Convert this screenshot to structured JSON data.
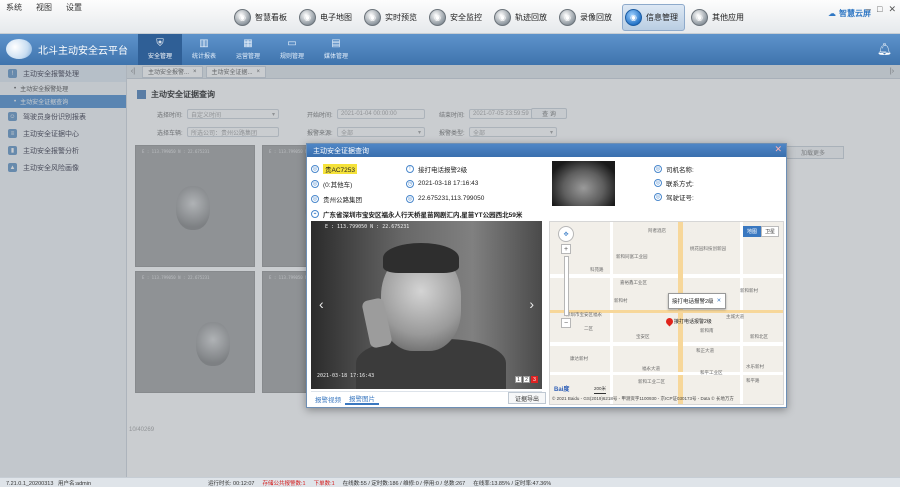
{
  "menubar": {
    "items": [
      "系统",
      "视图",
      "设置"
    ],
    "modules": [
      {
        "label": "智慧看板",
        "icon": "dashboard-icon",
        "active": false
      },
      {
        "label": "电子地图",
        "icon": "map-icon",
        "active": false
      },
      {
        "label": "实时预览",
        "icon": "preview-icon",
        "active": false
      },
      {
        "label": "安全监控",
        "icon": "monitor-icon",
        "active": false
      },
      {
        "label": "轨迹回放",
        "icon": "track-icon",
        "active": false
      },
      {
        "label": "录像回放",
        "icon": "video-icon",
        "active": false
      },
      {
        "label": "信息管理",
        "icon": "info-icon",
        "active": true
      },
      {
        "label": "其他应用",
        "icon": "apps-icon",
        "active": false
      }
    ],
    "brand_right": "智慧云屏"
  },
  "header": {
    "app_title": "北斗主动安全云平台",
    "tabs": [
      {
        "label": "安全管理",
        "icon": "shield-icon",
        "active": true
      },
      {
        "label": "统计报表",
        "icon": "chart-icon",
        "active": false
      },
      {
        "label": "运营管理",
        "icon": "ops-icon",
        "active": false
      },
      {
        "label": "规则管理",
        "icon": "rules-icon",
        "active": false
      },
      {
        "label": "媒体管理",
        "icon": "media-icon",
        "active": false
      }
    ]
  },
  "sidebar": {
    "items": [
      {
        "label": "主动安全报警处理",
        "icon": "alarm-icon",
        "parent": true
      },
      {
        "label": "主动安全报警处理",
        "sub": true,
        "active": false
      },
      {
        "label": "主动安全证据查询",
        "sub": true,
        "active": true
      },
      {
        "label": "驾驶员身份识别报表",
        "icon": "driver-icon"
      },
      {
        "label": "主动安全证据中心",
        "icon": "evidence-icon"
      },
      {
        "label": "主动安全报警分析",
        "icon": "analysis-icon"
      },
      {
        "label": "主动安全风险画像",
        "icon": "risk-icon"
      }
    ]
  },
  "tabstrip": {
    "tabs": [
      "主动安全报警...",
      "主动安全证据..."
    ]
  },
  "main": {
    "page_title": "主动安全证据查询",
    "filters": {
      "time_label": "选择时间:",
      "time_value": "自定义时间",
      "start_label": "开始时间:",
      "start_value": "2021-01-04 00:00:00",
      "end_label": "结束时间:",
      "end_value": "2021-07-05 23:59:59",
      "company_label": "选择车辆:",
      "company_value": "所选公司：贵州公路集团",
      "alarm_source_label": "报警来源:",
      "alarm_source_value": "全部",
      "alarm_type_label": "报警类型:",
      "alarm_type_value": "全部"
    },
    "query_button": "查 询",
    "load_more": "加载更多",
    "page_count": "10/40269",
    "thumbnail_timestamp": "E : 113.799050  N : 22.675231"
  },
  "modal": {
    "title": "主动安全证据查询",
    "plate": "贵AC7253",
    "alarm_type": "接打电话报警2级",
    "vehicle_color": "(0:其他车)",
    "time": "2021-03-18 17:16:43",
    "company": "贵州公路集团",
    "coords": "22.675231,113.799050",
    "address": "广东省深圳市宝安区福永人行天桥星苗网剧汇内,星苗YT公园西北59米",
    "driver_name_label": "司机名称:",
    "contact_label": "联系方式:",
    "license_label": "驾驶证号:",
    "video_overlay": "E : 113.799050  N : 22.675231",
    "video_date": "2021-03-18  17:16:43",
    "pager": [
      "1",
      "2",
      "3"
    ],
    "pager_current": "3",
    "bottom_tabs": [
      "报警视频",
      "报警图片"
    ],
    "bottom_tab_active": "报警图片",
    "export_button": "证据导出",
    "map": {
      "type_buttons": [
        "地图",
        "卫星"
      ],
      "type_selected": "地图",
      "popup_text": "接打电话报警2级",
      "pin_label": "接打电话报警2级",
      "scale": "200米",
      "logo": "Bai度",
      "copyright": "© 2021 Baidu - GS(2019)6218号 - 甲测资字1100930 - 京ICP证030173号 - Data © 长地万方",
      "labels": [
        "阿者酒店",
        "新和同富工业园",
        "桃花园科技创新园",
        "科苑路",
        "嘉裕鑫工业区",
        "新和村",
        "深圳市宝安区福永",
        "新和新村",
        "新和北区",
        "二区",
        "宝安区",
        "新和南",
        "康达新村",
        "和正大道",
        "福永大道",
        "新和工业二区",
        "和平工业区",
        "水乐新村",
        "主城大道",
        "和平路"
      ]
    }
  },
  "statusbar": {
    "version": "7.21.0.1_20200313",
    "user": "用户名:admin",
    "runtime": "运行时长: 00:12:07",
    "alarm_label": "存储公共报警数:1",
    "unhandled": "下单数:1",
    "online": "在线数:55 / 定时数:186 / 维修:0 / 停用:0 / 总数:267",
    "rate": "在线率:13.85% / 定时率:47.36%"
  }
}
